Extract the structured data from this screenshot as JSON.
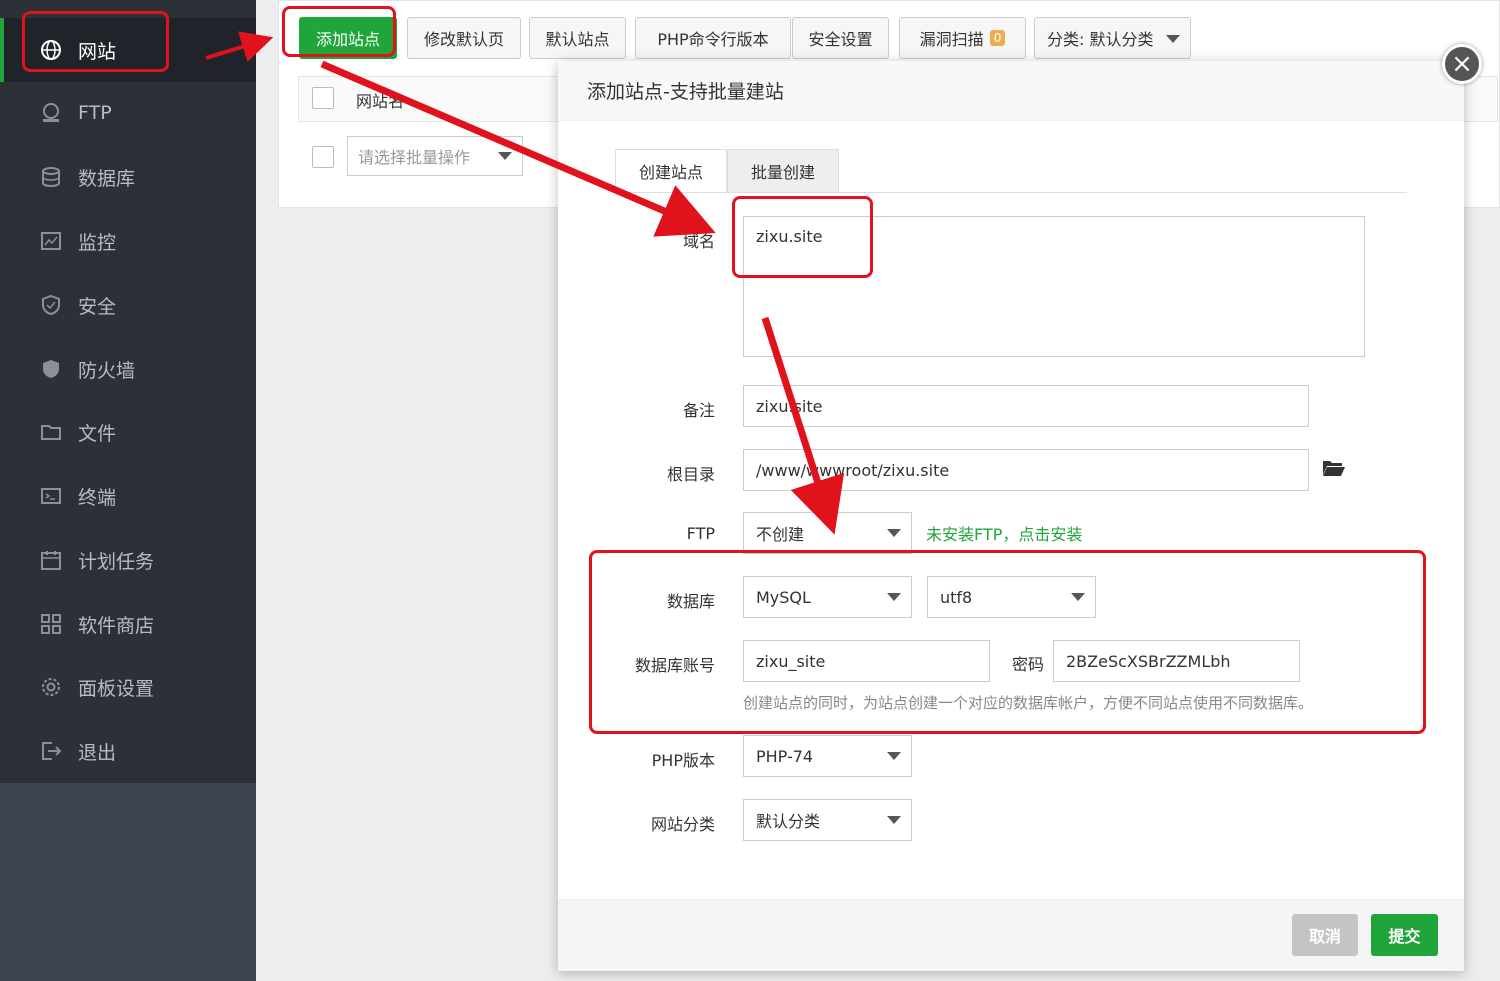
{
  "sidebar": {
    "items": [
      {
        "label": "网站",
        "icon": "globe-icon"
      },
      {
        "label": "FTP",
        "icon": "ftp-icon"
      },
      {
        "label": "数据库",
        "icon": "database-icon"
      },
      {
        "label": "监控",
        "icon": "monitor-icon"
      },
      {
        "label": "安全",
        "icon": "shield-icon"
      },
      {
        "label": "防火墙",
        "icon": "firewall-icon"
      },
      {
        "label": "文件",
        "icon": "folder-icon"
      },
      {
        "label": "终端",
        "icon": "terminal-icon"
      },
      {
        "label": "计划任务",
        "icon": "calendar-icon"
      },
      {
        "label": "软件商店",
        "icon": "apps-icon"
      },
      {
        "label": "面板设置",
        "icon": "gear-icon"
      },
      {
        "label": "退出",
        "icon": "logout-icon"
      }
    ]
  },
  "toolbar": {
    "add_site": "添加站点",
    "edit_default_page": "修改默认页",
    "default_site": "默认站点",
    "php_cli": "PHP命令行版本",
    "security": "安全设置",
    "vuln_scan": "漏洞扫描",
    "vuln_count": "0",
    "category": "分类: 默认分类"
  },
  "table": {
    "col_site_name": "网站名",
    "bulk_placeholder": "请选择批量操作"
  },
  "modal": {
    "title": "添加站点-支持批量建站",
    "tabs": [
      "创建站点",
      "批量创建"
    ],
    "domain_label": "域名",
    "domain_value": "zixu.site",
    "remark_label": "备注",
    "remark_value": "zixu.site",
    "root_label": "根目录",
    "root_value": "/www/wwwroot/zixu.site",
    "ftp_label": "FTP",
    "ftp_value": "不创建",
    "ftp_hint": "未安装FTP，点击安装",
    "db_label": "数据库",
    "db_type": "MySQL",
    "db_charset": "utf8",
    "db_account_label": "数据库账号",
    "db_account_value": "zixu_site",
    "password_label": "密码",
    "password_value": "2BZeScXSBrZZMLbh",
    "db_hint": "创建站点的同时，为站点创建一个对应的数据库帐户，方便不同站点使用不同数据库。",
    "php_label": "PHP版本",
    "php_value": "PHP-74",
    "category_label": "网站分类",
    "category_value": "默认分类",
    "cancel": "取消",
    "submit": "提交"
  },
  "colors": {
    "sidebar_bg": "#2c3138",
    "accent_green": "#20a53a",
    "annotation_red": "#e0121c",
    "cancel_gray": "#c4c4c4"
  }
}
